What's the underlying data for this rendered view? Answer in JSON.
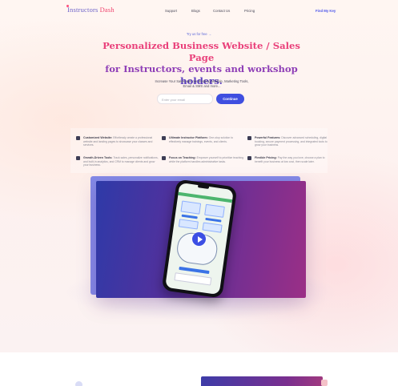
{
  "brand": {
    "name_part1": "Instructors",
    "name_part2": "Dash",
    "accent": "#f0446e",
    "primary": "#3f4fe0"
  },
  "nav": {
    "links": [
      "Support",
      "Blogs",
      "Contact Us",
      "Pricing"
    ],
    "cta": "Find My Key"
  },
  "hero": {
    "pill_link": "Try us for free  →",
    "headline_line1": "Personalized Business Website / Sales Page",
    "headline_line2": "for Instructors, events and workshop",
    "headline_line3": "holders.",
    "subtext": "Increase Your Sales with our Booking Module, Marketing Tools, Email & SMS and more...",
    "email_placeholder": "Enter your email",
    "continue_label": "Continue"
  },
  "features": [
    {
      "icon": "briefcase-icon",
      "title": "Customized Website:",
      "text": "Effortlessly create a professional website and landing pages to showcase your classes and services."
    },
    {
      "icon": "users-icon",
      "title": "Ultimate Instructor Platform:",
      "text": "One-stop solution to effectively manage trainings, events, and clients."
    },
    {
      "icon": "lightning-icon",
      "title": "Powerful Features:",
      "text": "Discover advanced scheduling, digital booking, secure payment processing, and integrated tools to grow your business."
    },
    {
      "icon": "chart-icon",
      "title": "Growth-Driven Tools:",
      "text": "Track sales, personalize notifications, and built-in analytics, and CRM to manage clients and grow your business."
    },
    {
      "icon": "calendar-icon",
      "title": "Focus on Teaching:",
      "text": "Empower yourself to prioritize teaching while the platform handles administrative tasks."
    },
    {
      "icon": "tag-icon",
      "title": "Flexible Pricing:",
      "text": "Pay the way you love, choose a plan to benefit your business at low cost, then scale later."
    }
  ],
  "video": {
    "play_icon": "play-icon"
  }
}
